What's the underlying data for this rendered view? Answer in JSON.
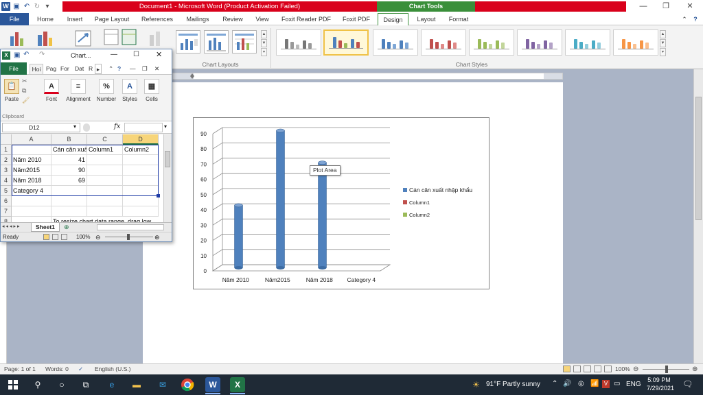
{
  "word": {
    "title": "Document1 - Microsoft Word (Product Activation Failed)",
    "context_title": "Chart Tools",
    "tabs": [
      "File",
      "Home",
      "Insert",
      "Page Layout",
      "References",
      "Mailings",
      "Review",
      "View",
      "Foxit Reader PDF",
      "Foxit PDF",
      "Design",
      "Layout",
      "Format"
    ],
    "groups": {
      "chart_layouts": "Chart Layouts",
      "chart_styles": "Chart Styles"
    },
    "accent": "#2b579a",
    "status": {
      "page": "Page: 1 of 1",
      "words": "Words: 0",
      "language": "English (U.S.)",
      "zoom": "100%"
    }
  },
  "chart": {
    "tooltip": "Plot Area",
    "legend": [
      "Cán cân xuất nhập khẩu",
      "Column1",
      "Column2"
    ],
    "series_colors": [
      "#4f81bd",
      "#c0504d",
      "#9bbb59"
    ]
  },
  "chart_data": {
    "type": "bar",
    "categories": [
      "Năm 2010",
      "Năm2015",
      "Năm 2018",
      "Category 4"
    ],
    "series": [
      {
        "name": "Cán cân xuất nhập khẩu",
        "values": [
          41,
          90,
          69,
          null
        ]
      },
      {
        "name": "Column1",
        "values": [
          null,
          null,
          null,
          null
        ]
      },
      {
        "name": "Column2",
        "values": [
          null,
          null,
          null,
          null
        ]
      }
    ],
    "title": "",
    "xlabel": "",
    "ylabel": "",
    "ylim": [
      0,
      90
    ],
    "yticks": [
      0,
      10,
      20,
      30,
      40,
      50,
      60,
      70,
      80,
      90
    ],
    "grid": true,
    "legend_position": "right"
  },
  "excel": {
    "title": "Chart...",
    "tabs": [
      "File",
      "Hoi",
      "Pag",
      "For",
      "Dat",
      "R"
    ],
    "ribbon": {
      "paste": "Paste",
      "clipboard": "Clipboard",
      "font": "Font",
      "alignment": "Alignment",
      "number": "Number",
      "styles": "Styles",
      "cells": "Cells",
      "percent": "%"
    },
    "name_box": "D12",
    "fx": "fx",
    "columns": [
      "A",
      "B",
      "C",
      "D"
    ],
    "rows": [
      {
        "num": "1",
        "cells": [
          "",
          "Cán cân xuất",
          "Column1",
          "Column2"
        ]
      },
      {
        "num": "2",
        "cells": [
          "Năm 2010",
          "41",
          "",
          ""
        ]
      },
      {
        "num": "3",
        "cells": [
          "Năm2015",
          "90",
          "",
          ""
        ]
      },
      {
        "num": "4",
        "cells": [
          "Năm 2018",
          "69",
          "",
          ""
        ]
      },
      {
        "num": "5",
        "cells": [
          "Category 4",
          "",
          "",
          ""
        ]
      },
      {
        "num": "6",
        "cells": [
          "",
          "",
          "",
          ""
        ]
      },
      {
        "num": "7",
        "cells": [
          "",
          "",
          "",
          ""
        ]
      },
      {
        "num": "8",
        "cells": [
          "",
          "To resize chart data range, drag low",
          "",
          ""
        ]
      }
    ],
    "sheet": "Sheet1",
    "status": "Ready",
    "zoom": "100%",
    "accent": "#217346"
  },
  "taskbar": {
    "weather": "91°F  Partly sunny",
    "lang": "ENG",
    "time": "5:09 PM",
    "date": "7/29/2021"
  }
}
